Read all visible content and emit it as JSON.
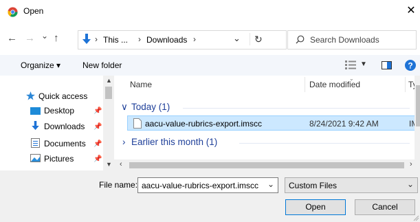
{
  "window": {
    "title": "Open",
    "close_glyph": "✕"
  },
  "address_bar": {
    "back": "←",
    "forward": "→",
    "recent": "⌄",
    "up": "↑",
    "crumbs": [
      "This ...",
      "Downloads"
    ],
    "separator": "›",
    "dropdown": "⌄",
    "refresh": "↻",
    "search_placeholder": "Search Downloads"
  },
  "command_bar": {
    "organize": "Organize ▾",
    "new_folder": "New folder"
  },
  "sidebar": {
    "items": [
      {
        "label": "Quick access",
        "icon": "star-icon"
      },
      {
        "label": "Desktop",
        "icon": "desktop-folder-icon"
      },
      {
        "label": "Downloads",
        "icon": "download-arrow-icon"
      },
      {
        "label": "Documents",
        "icon": "documents-folder-icon"
      },
      {
        "label": "Pictures",
        "icon": "pictures-folder-icon"
      }
    ]
  },
  "file_list": {
    "columns": [
      "Name",
      "Date modified",
      "Ty"
    ],
    "groups": [
      {
        "label": "Today (1)",
        "expanded": true
      },
      {
        "label": "Earlier this month (1)",
        "expanded": false
      }
    ],
    "rows": [
      {
        "name": "aacu-value-rubrics-export.imscc",
        "date": "8/24/2021 9:42 AM",
        "type": "IM"
      }
    ]
  },
  "bottom": {
    "file_name_label": "File name:",
    "file_name_value": "aacu-value-rubrics-export.imscc",
    "filter": "Custom Files",
    "open": "Open",
    "cancel": "Cancel"
  },
  "colors": {
    "accent": "#0078d7",
    "selected_row": "#cce8ff",
    "group_text": "#1e3f99"
  }
}
